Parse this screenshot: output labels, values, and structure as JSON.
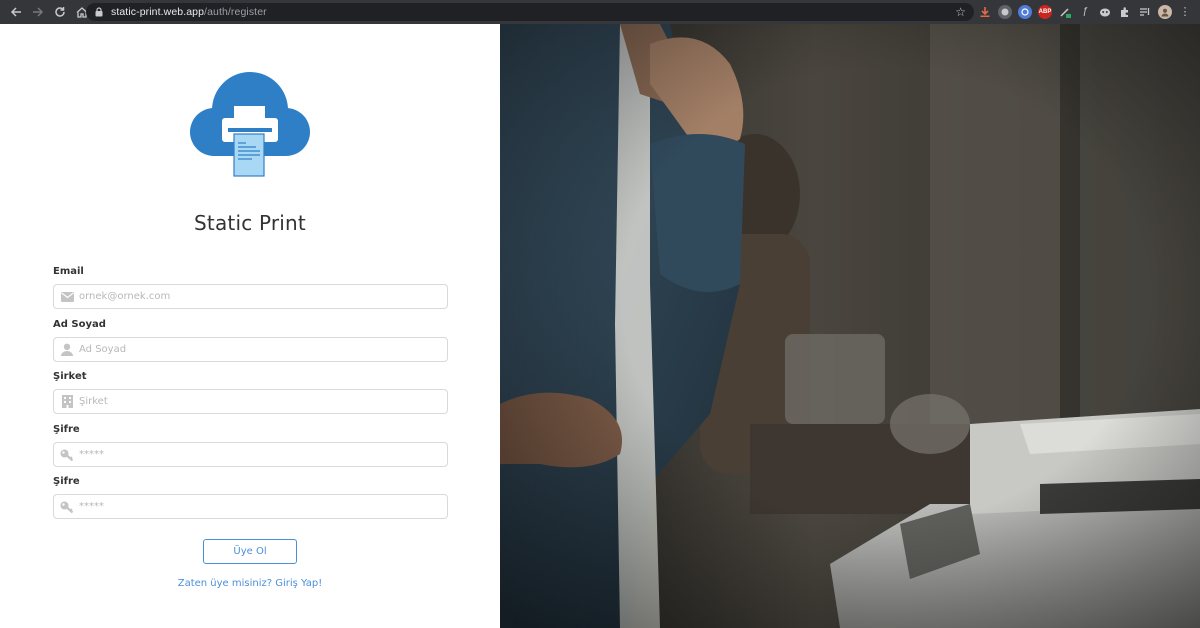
{
  "browser": {
    "url_host": "static-print.web.app",
    "url_path": "/auth/register",
    "icons": [
      "back-icon",
      "forward-icon",
      "reload-icon",
      "home-icon",
      "lock-icon",
      "star-icon",
      "extensions-icon",
      "menu-icon"
    ]
  },
  "app": {
    "title": "Static Print",
    "logo_colors": {
      "cloud": "#2f7fc6",
      "paper": "#a9d8f5"
    }
  },
  "form": {
    "fields": [
      {
        "label": "Email",
        "placeholder": "ornek@ornek.com",
        "value": "",
        "icon": "envelope-icon"
      },
      {
        "label": "Ad Soyad",
        "placeholder": "Ad Soyad",
        "value": "",
        "icon": "user-icon"
      },
      {
        "label": "Şirket",
        "placeholder": "Şirket",
        "value": "",
        "icon": "building-icon"
      },
      {
        "label": "Şifre",
        "placeholder": "*****",
        "value": "",
        "icon": "key-icon"
      },
      {
        "label": "Şifre",
        "placeholder": "*****",
        "value": "",
        "icon": "key-icon"
      }
    ],
    "submit_label": "Üye Ol",
    "login_link": "Zaten üye misiniz? Giriş Yap!"
  },
  "colors": {
    "accent": "#4a90d9",
    "chrome_bg": "#35363a",
    "omnibox_bg": "#202124"
  }
}
